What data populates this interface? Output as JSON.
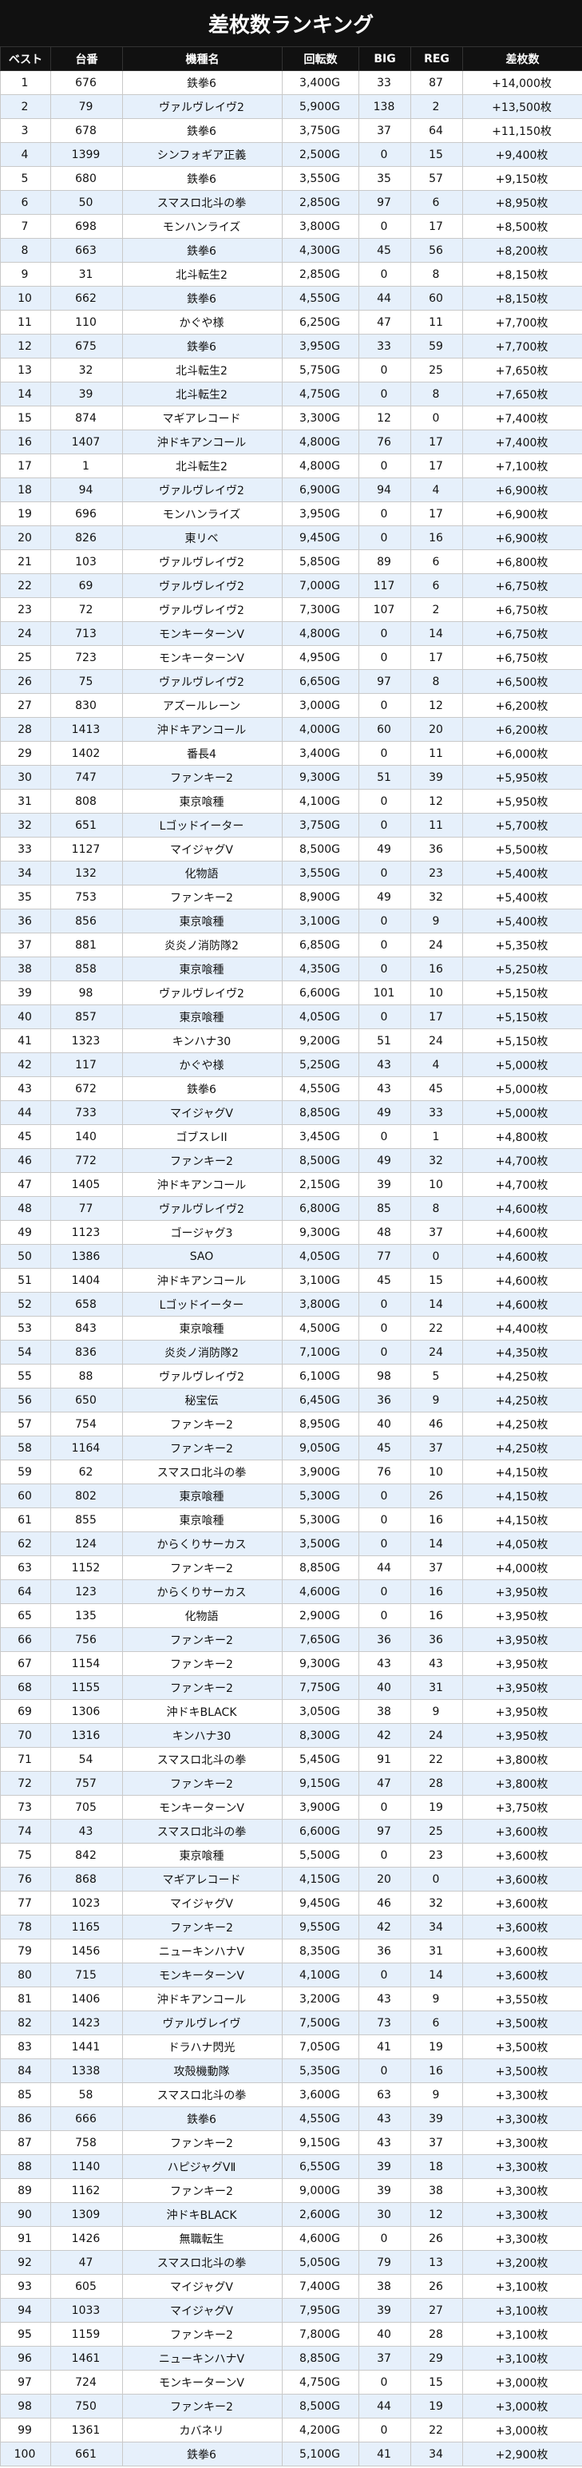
{
  "title": "差枚数ランキング",
  "headers": [
    "ベスト",
    "台番",
    "機種名",
    "回転数",
    "BIG",
    "REG",
    "差枚数"
  ],
  "rows": [
    [
      "1",
      "676",
      "鉄拳6",
      "3,400G",
      "33",
      "87",
      "+14,000枚"
    ],
    [
      "2",
      "79",
      "ヴァルヴレイヴ2",
      "5,900G",
      "138",
      "2",
      "+13,500枚"
    ],
    [
      "3",
      "678",
      "鉄拳6",
      "3,750G",
      "37",
      "64",
      "+11,150枚"
    ],
    [
      "4",
      "1399",
      "シンフォギア正義",
      "2,500G",
      "0",
      "15",
      "+9,400枚"
    ],
    [
      "5",
      "680",
      "鉄拳6",
      "3,550G",
      "35",
      "57",
      "+9,150枚"
    ],
    [
      "6",
      "50",
      "スマスロ北斗の拳",
      "2,850G",
      "97",
      "6",
      "+8,950枚"
    ],
    [
      "7",
      "698",
      "モンハンライズ",
      "3,800G",
      "0",
      "17",
      "+8,500枚"
    ],
    [
      "8",
      "663",
      "鉄拳6",
      "4,300G",
      "45",
      "56",
      "+8,200枚"
    ],
    [
      "9",
      "31",
      "北斗転生2",
      "2,850G",
      "0",
      "8",
      "+8,150枚"
    ],
    [
      "10",
      "662",
      "鉄拳6",
      "4,550G",
      "44",
      "60",
      "+8,150枚"
    ],
    [
      "11",
      "110",
      "かぐや様",
      "6,250G",
      "47",
      "11",
      "+7,700枚"
    ],
    [
      "12",
      "675",
      "鉄拳6",
      "3,950G",
      "33",
      "59",
      "+7,700枚"
    ],
    [
      "13",
      "32",
      "北斗転生2",
      "5,750G",
      "0",
      "25",
      "+7,650枚"
    ],
    [
      "14",
      "39",
      "北斗転生2",
      "4,750G",
      "0",
      "8",
      "+7,650枚"
    ],
    [
      "15",
      "874",
      "マギアレコード",
      "3,300G",
      "12",
      "0",
      "+7,400枚"
    ],
    [
      "16",
      "1407",
      "沖ドキアンコール",
      "4,800G",
      "76",
      "17",
      "+7,400枚"
    ],
    [
      "17",
      "1",
      "北斗転生2",
      "4,800G",
      "0",
      "17",
      "+7,100枚"
    ],
    [
      "18",
      "94",
      "ヴァルヴレイヴ2",
      "6,900G",
      "94",
      "4",
      "+6,900枚"
    ],
    [
      "19",
      "696",
      "モンハンライズ",
      "3,950G",
      "0",
      "17",
      "+6,900枚"
    ],
    [
      "20",
      "826",
      "東リベ",
      "9,450G",
      "0",
      "16",
      "+6,900枚"
    ],
    [
      "21",
      "103",
      "ヴァルヴレイヴ2",
      "5,850G",
      "89",
      "6",
      "+6,800枚"
    ],
    [
      "22",
      "69",
      "ヴァルヴレイヴ2",
      "7,000G",
      "117",
      "6",
      "+6,750枚"
    ],
    [
      "23",
      "72",
      "ヴァルヴレイヴ2",
      "7,300G",
      "107",
      "2",
      "+6,750枚"
    ],
    [
      "24",
      "713",
      "モンキーターンV",
      "4,800G",
      "0",
      "14",
      "+6,750枚"
    ],
    [
      "25",
      "723",
      "モンキーターンV",
      "4,950G",
      "0",
      "17",
      "+6,750枚"
    ],
    [
      "26",
      "75",
      "ヴァルヴレイヴ2",
      "6,650G",
      "97",
      "8",
      "+6,500枚"
    ],
    [
      "27",
      "830",
      "アズールレーン",
      "3,000G",
      "0",
      "12",
      "+6,200枚"
    ],
    [
      "28",
      "1413",
      "沖ドキアンコール",
      "4,000G",
      "60",
      "20",
      "+6,200枚"
    ],
    [
      "29",
      "1402",
      "番長4",
      "3,400G",
      "0",
      "11",
      "+6,000枚"
    ],
    [
      "30",
      "747",
      "ファンキー2",
      "9,300G",
      "51",
      "39",
      "+5,950枚"
    ],
    [
      "31",
      "808",
      "東京喰種",
      "4,100G",
      "0",
      "12",
      "+5,950枚"
    ],
    [
      "32",
      "651",
      "Lゴッドイーター",
      "3,750G",
      "0",
      "11",
      "+5,700枚"
    ],
    [
      "33",
      "1127",
      "マイジャグV",
      "8,500G",
      "49",
      "36",
      "+5,500枚"
    ],
    [
      "34",
      "132",
      "化物語",
      "3,550G",
      "0",
      "23",
      "+5,400枚"
    ],
    [
      "35",
      "753",
      "ファンキー2",
      "8,900G",
      "49",
      "32",
      "+5,400枚"
    ],
    [
      "36",
      "856",
      "東京喰種",
      "3,100G",
      "0",
      "9",
      "+5,400枚"
    ],
    [
      "37",
      "881",
      "炎炎ノ消防隊2",
      "6,850G",
      "0",
      "24",
      "+5,350枚"
    ],
    [
      "38",
      "858",
      "東京喰種",
      "4,350G",
      "0",
      "16",
      "+5,250枚"
    ],
    [
      "39",
      "98",
      "ヴァルヴレイヴ2",
      "6,600G",
      "101",
      "10",
      "+5,150枚"
    ],
    [
      "40",
      "857",
      "東京喰種",
      "4,050G",
      "0",
      "17",
      "+5,150枚"
    ],
    [
      "41",
      "1323",
      "キンハナ30",
      "9,200G",
      "51",
      "24",
      "+5,150枚"
    ],
    [
      "42",
      "117",
      "かぐや様",
      "5,250G",
      "43",
      "4",
      "+5,000枚"
    ],
    [
      "43",
      "672",
      "鉄拳6",
      "4,550G",
      "43",
      "45",
      "+5,000枚"
    ],
    [
      "44",
      "733",
      "マイジャグV",
      "8,850G",
      "49",
      "33",
      "+5,000枚"
    ],
    [
      "45",
      "140",
      "ゴブスレII",
      "3,450G",
      "0",
      "1",
      "+4,800枚"
    ],
    [
      "46",
      "772",
      "ファンキー2",
      "8,500G",
      "49",
      "32",
      "+4,700枚"
    ],
    [
      "47",
      "1405",
      "沖ドキアンコール",
      "2,150G",
      "39",
      "10",
      "+4,700枚"
    ],
    [
      "48",
      "77",
      "ヴァルヴレイヴ2",
      "6,800G",
      "85",
      "8",
      "+4,600枚"
    ],
    [
      "49",
      "1123",
      "ゴージャグ3",
      "9,300G",
      "48",
      "37",
      "+4,600枚"
    ],
    [
      "50",
      "1386",
      "SAO",
      "4,050G",
      "77",
      "0",
      "+4,600枚"
    ],
    [
      "51",
      "1404",
      "沖ドキアンコール",
      "3,100G",
      "45",
      "15",
      "+4,600枚"
    ],
    [
      "52",
      "658",
      "Lゴッドイーター",
      "3,800G",
      "0",
      "14",
      "+4,600枚"
    ],
    [
      "53",
      "843",
      "東京喰種",
      "4,500G",
      "0",
      "22",
      "+4,400枚"
    ],
    [
      "54",
      "836",
      "炎炎ノ消防隊2",
      "7,100G",
      "0",
      "24",
      "+4,350枚"
    ],
    [
      "55",
      "88",
      "ヴァルヴレイヴ2",
      "6,100G",
      "98",
      "5",
      "+4,250枚"
    ],
    [
      "56",
      "650",
      "秘宝伝",
      "6,450G",
      "36",
      "9",
      "+4,250枚"
    ],
    [
      "57",
      "754",
      "ファンキー2",
      "8,950G",
      "40",
      "46",
      "+4,250枚"
    ],
    [
      "58",
      "1164",
      "ファンキー2",
      "9,050G",
      "45",
      "37",
      "+4,250枚"
    ],
    [
      "59",
      "62",
      "スマスロ北斗の拳",
      "3,900G",
      "76",
      "10",
      "+4,150枚"
    ],
    [
      "60",
      "802",
      "東京喰種",
      "5,300G",
      "0",
      "26",
      "+4,150枚"
    ],
    [
      "61",
      "855",
      "東京喰種",
      "5,300G",
      "0",
      "16",
      "+4,150枚"
    ],
    [
      "62",
      "124",
      "からくりサーカス",
      "3,500G",
      "0",
      "14",
      "+4,050枚"
    ],
    [
      "63",
      "1152",
      "ファンキー2",
      "8,850G",
      "44",
      "37",
      "+4,000枚"
    ],
    [
      "64",
      "123",
      "からくりサーカス",
      "4,600G",
      "0",
      "16",
      "+3,950枚"
    ],
    [
      "65",
      "135",
      "化物語",
      "2,900G",
      "0",
      "16",
      "+3,950枚"
    ],
    [
      "66",
      "756",
      "ファンキー2",
      "7,650G",
      "36",
      "36",
      "+3,950枚"
    ],
    [
      "67",
      "1154",
      "ファンキー2",
      "9,300G",
      "43",
      "43",
      "+3,950枚"
    ],
    [
      "68",
      "1155",
      "ファンキー2",
      "7,750G",
      "40",
      "31",
      "+3,950枚"
    ],
    [
      "69",
      "1306",
      "沖ドキBLACK",
      "3,050G",
      "38",
      "9",
      "+3,950枚"
    ],
    [
      "70",
      "1316",
      "キンハナ30",
      "8,300G",
      "42",
      "24",
      "+3,950枚"
    ],
    [
      "71",
      "54",
      "スマスロ北斗の拳",
      "5,450G",
      "91",
      "22",
      "+3,800枚"
    ],
    [
      "72",
      "757",
      "ファンキー2",
      "9,150G",
      "47",
      "28",
      "+3,800枚"
    ],
    [
      "73",
      "705",
      "モンキーターンV",
      "3,900G",
      "0",
      "19",
      "+3,750枚"
    ],
    [
      "74",
      "43",
      "スマスロ北斗の拳",
      "6,600G",
      "97",
      "25",
      "+3,600枚"
    ],
    [
      "75",
      "842",
      "東京喰種",
      "5,500G",
      "0",
      "23",
      "+3,600枚"
    ],
    [
      "76",
      "868",
      "マギアレコード",
      "4,150G",
      "20",
      "0",
      "+3,600枚"
    ],
    [
      "77",
      "1023",
      "マイジャグV",
      "9,450G",
      "46",
      "32",
      "+3,600枚"
    ],
    [
      "78",
      "1165",
      "ファンキー2",
      "9,550G",
      "42",
      "34",
      "+3,600枚"
    ],
    [
      "79",
      "1456",
      "ニューキンハナV",
      "8,350G",
      "36",
      "31",
      "+3,600枚"
    ],
    [
      "80",
      "715",
      "モンキーターンV",
      "4,100G",
      "0",
      "14",
      "+3,600枚"
    ],
    [
      "81",
      "1406",
      "沖ドキアンコール",
      "3,200G",
      "43",
      "9",
      "+3,550枚"
    ],
    [
      "82",
      "1423",
      "ヴァルヴレイヴ",
      "7,500G",
      "73",
      "6",
      "+3,500枚"
    ],
    [
      "83",
      "1441",
      "ドラハナ閃光",
      "7,050G",
      "41",
      "19",
      "+3,500枚"
    ],
    [
      "84",
      "1338",
      "攻殻機動隊",
      "5,350G",
      "0",
      "16",
      "+3,500枚"
    ],
    [
      "85",
      "58",
      "スマスロ北斗の拳",
      "3,600G",
      "63",
      "9",
      "+3,300枚"
    ],
    [
      "86",
      "666",
      "鉄拳6",
      "4,550G",
      "43",
      "39",
      "+3,300枚"
    ],
    [
      "87",
      "758",
      "ファンキー2",
      "9,150G",
      "43",
      "37",
      "+3,300枚"
    ],
    [
      "88",
      "1140",
      "ハピジャグVⅡ",
      "6,550G",
      "39",
      "18",
      "+3,300枚"
    ],
    [
      "89",
      "1162",
      "ファンキー2",
      "9,000G",
      "39",
      "38",
      "+3,300枚"
    ],
    [
      "90",
      "1309",
      "沖ドキBLACK",
      "2,600G",
      "30",
      "12",
      "+3,300枚"
    ],
    [
      "91",
      "1426",
      "無職転生",
      "4,600G",
      "0",
      "26",
      "+3,300枚"
    ],
    [
      "92",
      "47",
      "スマスロ北斗の拳",
      "5,050G",
      "79",
      "13",
      "+3,200枚"
    ],
    [
      "93",
      "605",
      "マイジャグV",
      "7,400G",
      "38",
      "26",
      "+3,100枚"
    ],
    [
      "94",
      "1033",
      "マイジャグV",
      "7,950G",
      "39",
      "27",
      "+3,100枚"
    ],
    [
      "95",
      "1159",
      "ファンキー2",
      "7,800G",
      "40",
      "28",
      "+3,100枚"
    ],
    [
      "96",
      "1461",
      "ニューキンハナV",
      "8,850G",
      "37",
      "29",
      "+3,100枚"
    ],
    [
      "97",
      "724",
      "モンキーターンV",
      "4,750G",
      "0",
      "15",
      "+3,000枚"
    ],
    [
      "98",
      "750",
      "ファンキー2",
      "8,500G",
      "44",
      "19",
      "+3,000枚"
    ],
    [
      "99",
      "1361",
      "カバネリ",
      "4,200G",
      "0",
      "22",
      "+3,000枚"
    ],
    [
      "100",
      "661",
      "鉄拳6",
      "5,100G",
      "41",
      "34",
      "+2,900枚"
    ]
  ]
}
